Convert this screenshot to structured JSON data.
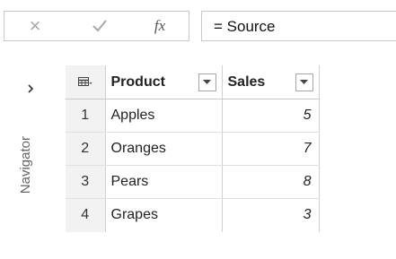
{
  "formula_bar": {
    "formula": "= Source"
  },
  "navigator": {
    "label": "Navigator"
  },
  "table": {
    "columns": [
      {
        "name": "Product"
      },
      {
        "name": "Sales"
      }
    ],
    "rows": [
      {
        "index": "1",
        "product": "Apples",
        "sales": "5"
      },
      {
        "index": "2",
        "product": "Oranges",
        "sales": "7"
      },
      {
        "index": "3",
        "product": "Pears",
        "sales": "8"
      },
      {
        "index": "4",
        "product": "Grapes",
        "sales": "3"
      }
    ]
  },
  "icons": {
    "cancel": "close-icon",
    "commit": "checkmark-icon",
    "fx": "function-icon",
    "expand": "chevron-right-icon",
    "table_menu": "table-icon",
    "dropdown": "chevron-down-icon"
  },
  "colors": {
    "border": "#c8c8c8",
    "index_bg": "#f2f2f2",
    "muted_icon": "#a8a8a8"
  }
}
